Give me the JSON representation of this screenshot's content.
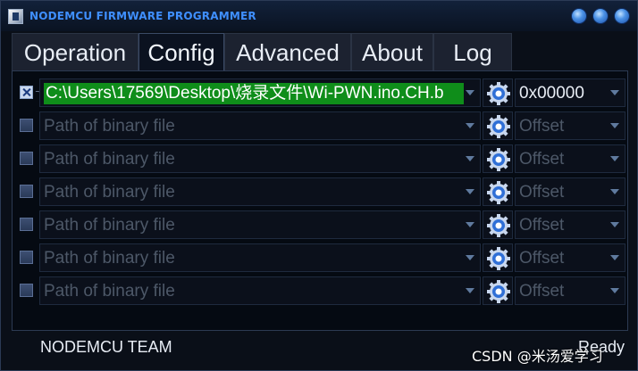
{
  "window": {
    "title": "NODEMCU FIRMWARE PROGRAMMER",
    "accent_color": "#3f8fff"
  },
  "tabs": [
    {
      "label": "Operation",
      "active": false
    },
    {
      "label": "Config",
      "active": true
    },
    {
      "label": "Advanced",
      "active": false
    },
    {
      "label": "About",
      "active": false
    },
    {
      "label": "Log",
      "active": false
    }
  ],
  "rows": [
    {
      "checked": true,
      "path": "C:\\Users\\17569\\Desktop\\烧录文件\\Wi-PWN.ino.CH.b",
      "offset": "0x00000",
      "path_highlight": "#0f8d1a"
    },
    {
      "checked": false,
      "path_placeholder": "Path of binary file",
      "offset_placeholder": "Offset"
    },
    {
      "checked": false,
      "path_placeholder": "Path of binary file",
      "offset_placeholder": "Offset"
    },
    {
      "checked": false,
      "path_placeholder": "Path of binary file",
      "offset_placeholder": "Offset"
    },
    {
      "checked": false,
      "path_placeholder": "Path of binary file",
      "offset_placeholder": "Offset"
    },
    {
      "checked": false,
      "path_placeholder": "Path of binary file",
      "offset_placeholder": "Offset"
    },
    {
      "checked": false,
      "path_placeholder": "Path of binary file",
      "offset_placeholder": "Offset"
    }
  ],
  "status": {
    "team": "NODEMCU TEAM",
    "state": "Ready"
  },
  "watermark": "CSDN @米汤爱学习"
}
